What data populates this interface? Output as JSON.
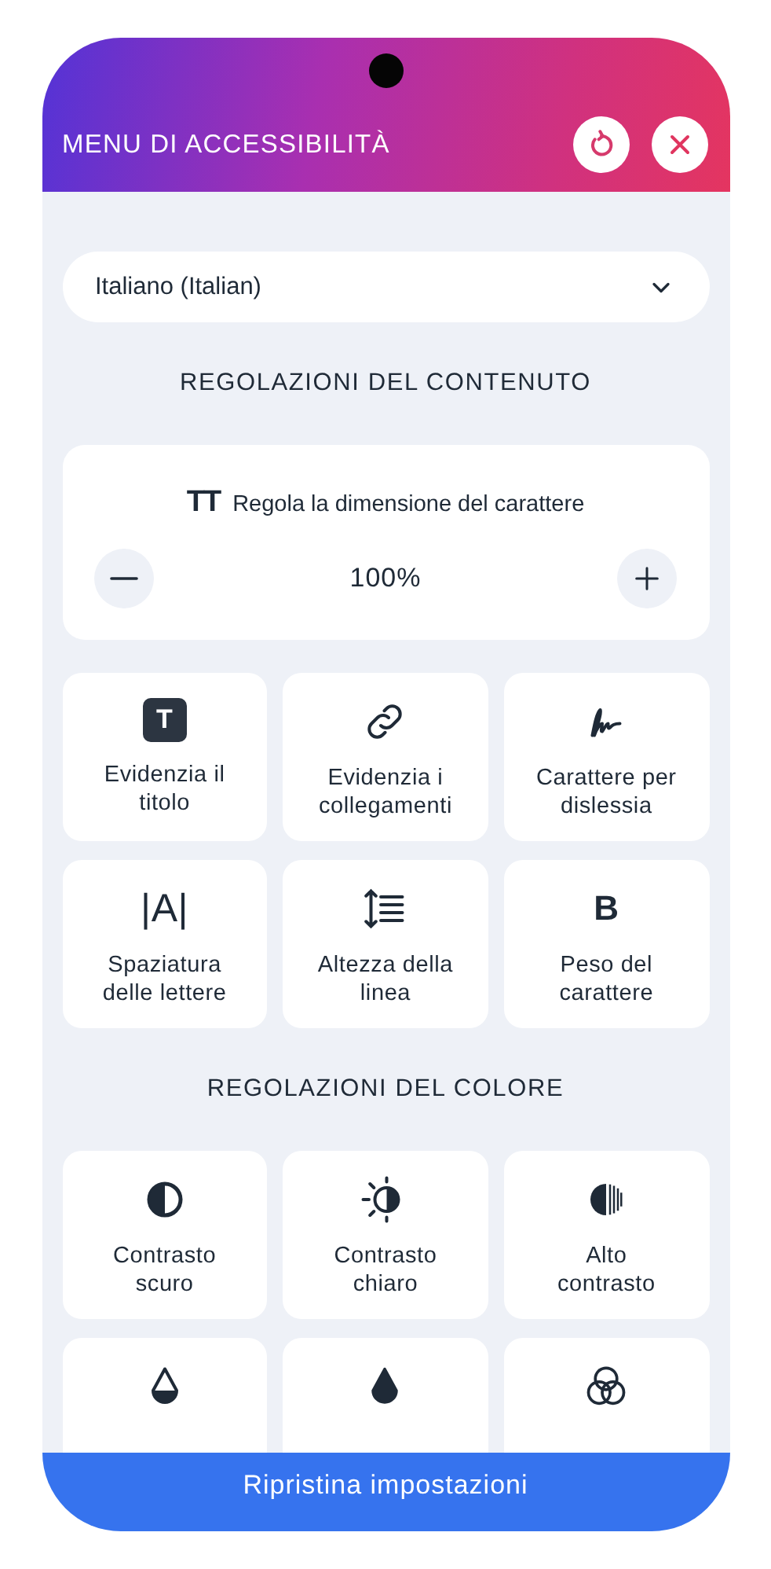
{
  "header": {
    "title": "MENU DI ACCESSIBILITÀ"
  },
  "language": {
    "value": "Italiano (Italian)"
  },
  "content_section": {
    "title": "REGOLAZIONI DEL CONTENUTO"
  },
  "font_size": {
    "glyph": "TT",
    "label": "Regola la dimensione del carattere",
    "value": "100%"
  },
  "content_tiles": [
    {
      "kind": "heading",
      "glyph": "T",
      "label": "Evidenzia il titolo"
    },
    {
      "kind": "link",
      "label": "Evidenzia i collegamenti"
    },
    {
      "kind": "dyslexia",
      "label": "Carattere per dislessia"
    },
    {
      "kind": "spacing",
      "glyph": "|A|",
      "label": "Spaziatura delle lettere"
    },
    {
      "kind": "line-height",
      "label": "Altezza della linea"
    },
    {
      "kind": "weight",
      "glyph": "B",
      "label": "Peso del carattere"
    }
  ],
  "color_section": {
    "title": "REGOLAZIONI DEL COLORE"
  },
  "color_tiles": [
    {
      "kind": "contrast-dark",
      "label": "Contrasto scuro"
    },
    {
      "kind": "contrast-light",
      "label": "Contrasto chiaro"
    },
    {
      "kind": "contrast-high",
      "label": "Alto contrasto"
    },
    {
      "kind": "drop-low"
    },
    {
      "kind": "drop-high"
    },
    {
      "kind": "circles"
    }
  ],
  "reset_button": {
    "label": "Ripristina impostazioni"
  }
}
